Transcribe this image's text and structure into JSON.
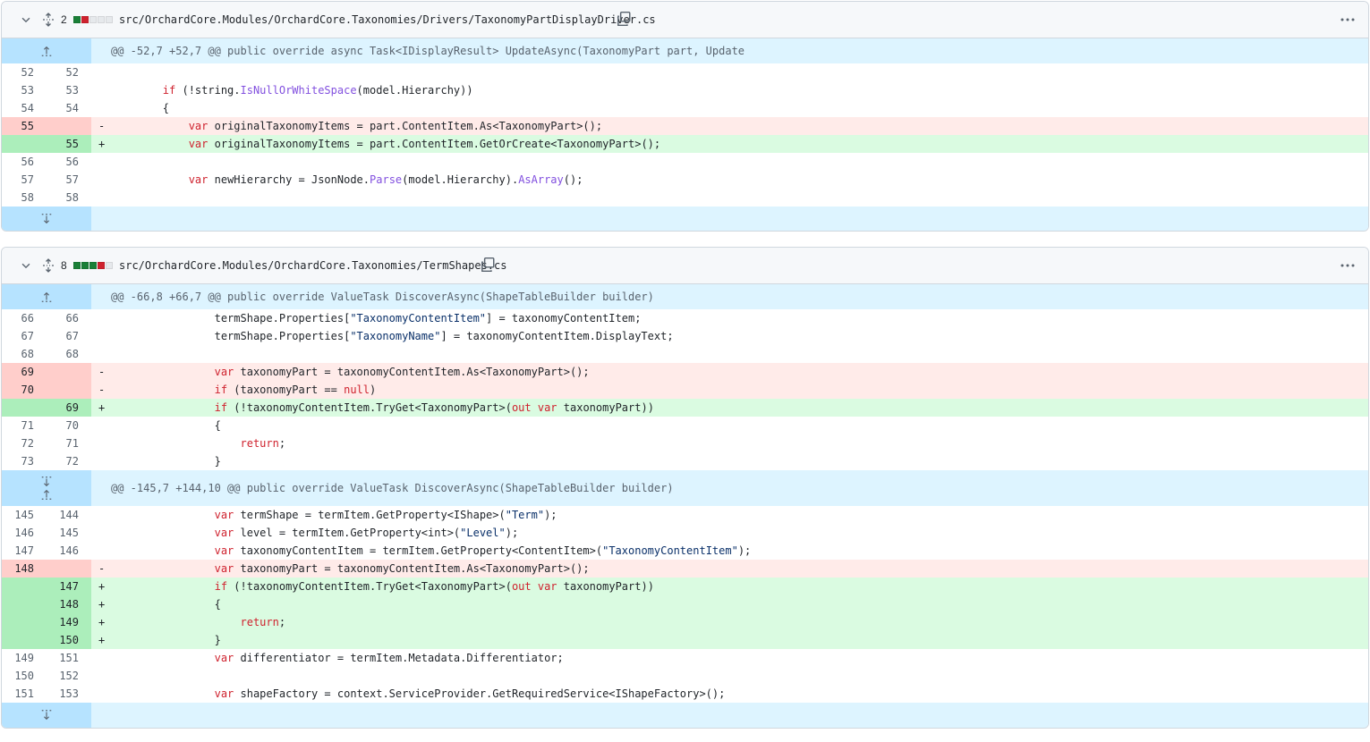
{
  "files": [
    {
      "changes": "2",
      "path": "src/OrchardCore.Modules/OrchardCore.Taxonomies/Drivers/TaxonomyPartDisplayDriver.cs",
      "hunk_header": "@@ -52,7 +52,7 @@ public override async Task<IDisplayResult> UpdateAsync(TaxonomyPart part, Update",
      "lines": [
        {
          "old": "52",
          "new": "52",
          "sign": "",
          "code": ""
        },
        {
          "old": "53",
          "new": "53",
          "sign": "",
          "code": "        if (!string.IsNullOrWhiteSpace(model.Hierarchy))"
        },
        {
          "old": "54",
          "new": "54",
          "sign": "",
          "code": "        {"
        },
        {
          "old": "55",
          "new": "",
          "sign": "-",
          "code": "            var originalTaxonomyItems = part.ContentItem.As<TaxonomyPart>();"
        },
        {
          "old": "",
          "new": "55",
          "sign": "+",
          "code": "            var originalTaxonomyItems = part.ContentItem.GetOrCreate<TaxonomyPart>();"
        },
        {
          "old": "56",
          "new": "56",
          "sign": "",
          "code": ""
        },
        {
          "old": "57",
          "new": "57",
          "sign": "",
          "code": "            var newHierarchy = JsonNode.Parse(model.Hierarchy).AsArray();"
        },
        {
          "old": "58",
          "new": "58",
          "sign": "",
          "code": ""
        }
      ]
    },
    {
      "changes": "8",
      "path": "src/OrchardCore.Modules/OrchardCore.Taxonomies/TermShapes.cs",
      "hunk_header": "@@ -66,8 +66,7 @@ public override ValueTask DiscoverAsync(ShapeTableBuilder builder)",
      "hunk_header_2": "@@ -145,7 +144,10 @@ public override ValueTask DiscoverAsync(ShapeTableBuilder builder)",
      "lines": [
        {
          "old": "66",
          "new": "66",
          "sign": "",
          "code": "                termShape.Properties[\"TaxonomyContentItem\"] = taxonomyContentItem;"
        },
        {
          "old": "67",
          "new": "67",
          "sign": "",
          "code": "                termShape.Properties[\"TaxonomyName\"] = taxonomyContentItem.DisplayText;"
        },
        {
          "old": "68",
          "new": "68",
          "sign": "",
          "code": ""
        },
        {
          "old": "69",
          "new": "",
          "sign": "-",
          "code": "                var taxonomyPart = taxonomyContentItem.As<TaxonomyPart>();"
        },
        {
          "old": "70",
          "new": "",
          "sign": "-",
          "code": "                if (taxonomyPart == null)"
        },
        {
          "old": "",
          "new": "69",
          "sign": "+",
          "code": "                if (!taxonomyContentItem.TryGet<TaxonomyPart>(out var taxonomyPart))"
        },
        {
          "old": "71",
          "new": "70",
          "sign": "",
          "code": "                {"
        },
        {
          "old": "72",
          "new": "71",
          "sign": "",
          "code": "                    return;"
        },
        {
          "old": "73",
          "new": "72",
          "sign": "",
          "code": "                }"
        }
      ],
      "lines_2": [
        {
          "old": "145",
          "new": "144",
          "sign": "",
          "code": "                var termShape = termItem.GetProperty<IShape>(\"Term\");"
        },
        {
          "old": "146",
          "new": "145",
          "sign": "",
          "code": "                var level = termItem.GetProperty<int>(\"Level\");"
        },
        {
          "old": "147",
          "new": "146",
          "sign": "",
          "code": "                var taxonomyContentItem = termItem.GetProperty<ContentItem>(\"TaxonomyContentItem\");"
        },
        {
          "old": "148",
          "new": "",
          "sign": "-",
          "code": "                var taxonomyPart = taxonomyContentItem.As<TaxonomyPart>();"
        },
        {
          "old": "",
          "new": "147",
          "sign": "+",
          "code": "                if (!taxonomyContentItem.TryGet<TaxonomyPart>(out var taxonomyPart))"
        },
        {
          "old": "",
          "new": "148",
          "sign": "+",
          "code": "                {"
        },
        {
          "old": "",
          "new": "149",
          "sign": "+",
          "code": "                    return;"
        },
        {
          "old": "",
          "new": "150",
          "sign": "+",
          "code": "                }"
        },
        {
          "old": "149",
          "new": "151",
          "sign": "",
          "code": "                var differentiator = termItem.Metadata.Differentiator;"
        },
        {
          "old": "150",
          "new": "152",
          "sign": "",
          "code": ""
        },
        {
          "old": "151",
          "new": "153",
          "sign": "",
          "code": "                var shapeFactory = context.ServiceProvider.GetRequiredService<IShapeFactory>();"
        }
      ]
    }
  ],
  "colors": {
    "add_bg": "#dafbe1",
    "add_gutter": "#aceebb",
    "del_bg": "#ffebe9",
    "del_gutter": "#ffcecb",
    "hunk_bg": "#ddf4ff",
    "hunk_gutter": "#b6e3ff"
  },
  "icons": [
    "chevron-down-icon",
    "unfold-icon",
    "copy-icon",
    "kebab-horizontal-icon",
    "expand-up-icon",
    "expand-down-icon"
  ]
}
